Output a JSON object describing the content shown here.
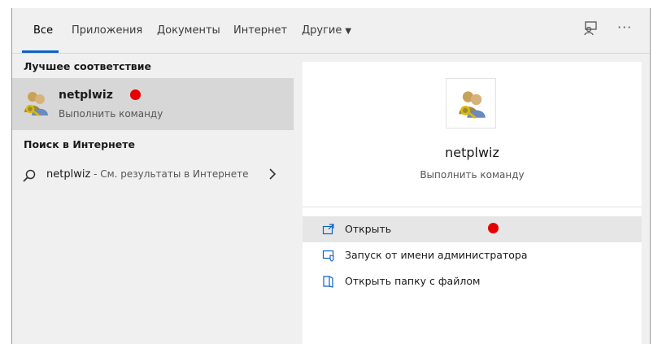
{
  "tabs": [
    {
      "label": "Все",
      "active": true
    },
    {
      "label": "Приложения"
    },
    {
      "label": "Документы"
    },
    {
      "label": "Интернет"
    },
    {
      "label": "Другие"
    }
  ],
  "left": {
    "best_match_heading": "Лучшее соответствие",
    "best_match": {
      "title": "netplwiz",
      "subtitle": "Выполнить команду",
      "icon": "users-key-icon"
    },
    "web_heading": "Поиск в Интернете",
    "web_result": {
      "query": "netplwiz",
      "suffix": " - См. результаты в Интернете"
    }
  },
  "preview": {
    "title": "netplwiz",
    "subtitle": "Выполнить команду",
    "actions": [
      {
        "label": "Открыть",
        "icon": "open-icon",
        "highlighted": true
      },
      {
        "label": "Запуск от имени администратора",
        "icon": "shield-icon"
      },
      {
        "label": "Открыть папку с файлом",
        "icon": "folder-file-icon"
      }
    ]
  },
  "colors": {
    "accent": "#0f62c4",
    "marker": "#e60000"
  }
}
